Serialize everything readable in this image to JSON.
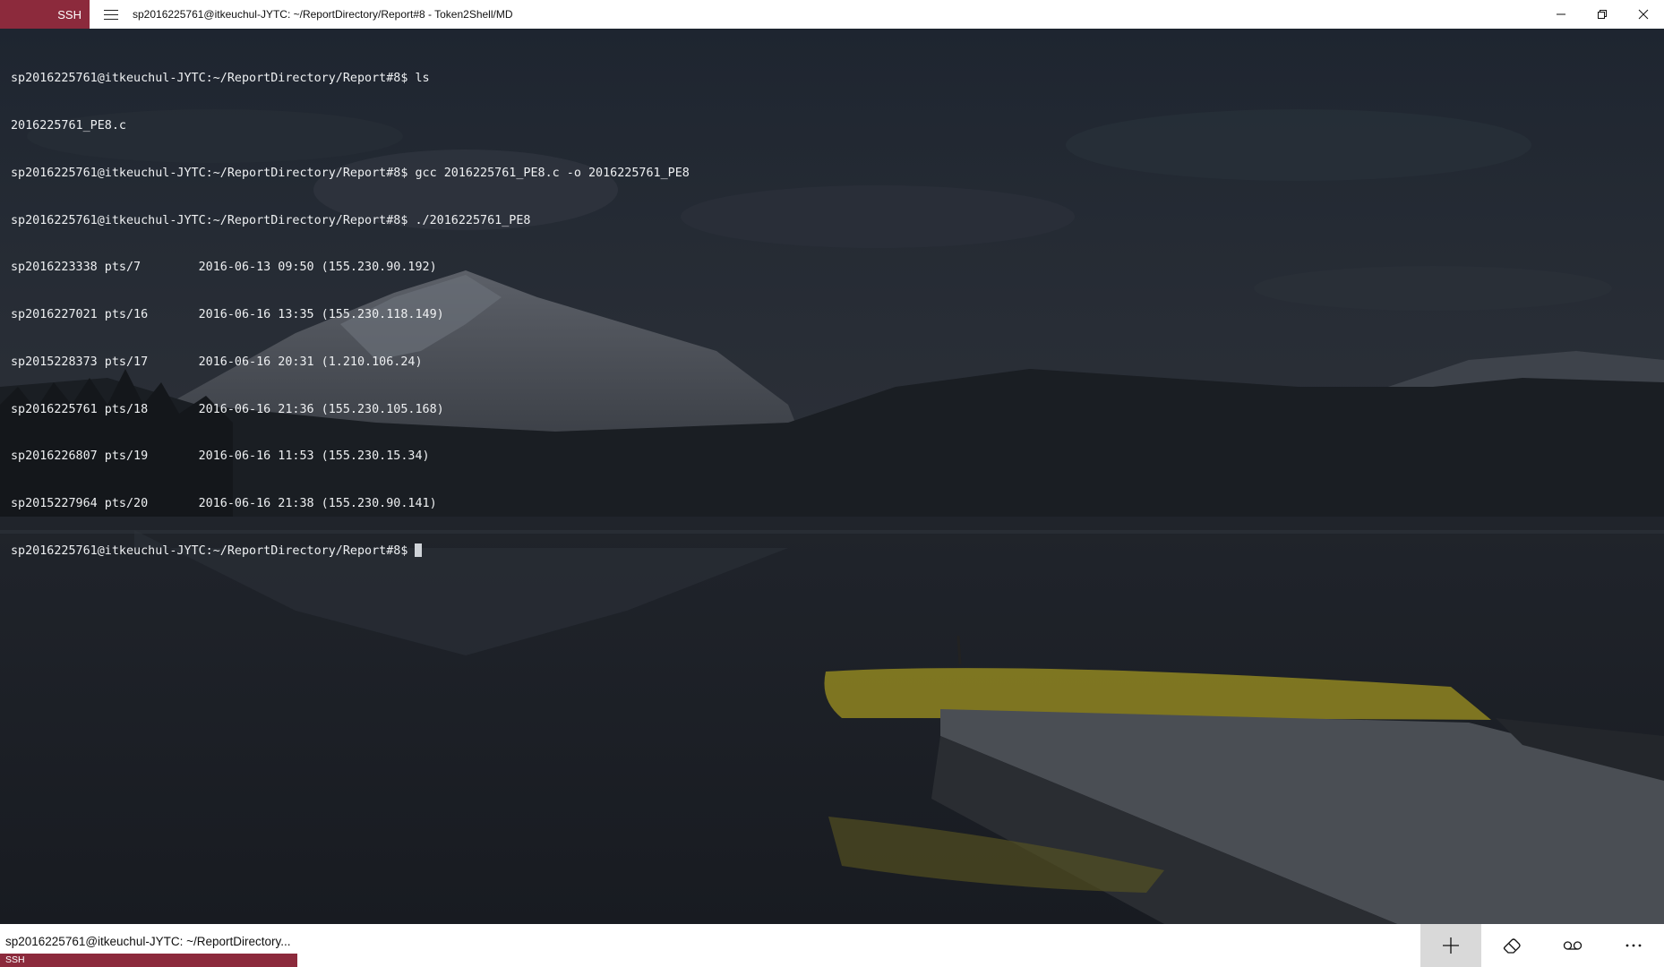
{
  "app": {
    "badge_label": "SSH",
    "window_title": "sp2016225761@itkeuchul-JYTC: ~/ReportDirectory/Report#8 - Token2Shell/MD",
    "accent_color": "#8c2a3c"
  },
  "window_controls": {
    "minimize_icon": "minimize-icon",
    "restore_icon": "restore-icon",
    "close_icon": "close-icon"
  },
  "terminal": {
    "lines": [
      "sp2016225761@itkeuchul-JYTC:~/ReportDirectory/Report#8$ ls",
      "2016225761_PE8.c",
      "sp2016225761@itkeuchul-JYTC:~/ReportDirectory/Report#8$ gcc 2016225761_PE8.c -o 2016225761_PE8",
      "sp2016225761@itkeuchul-JYTC:~/ReportDirectory/Report#8$ ./2016225761_PE8",
      "sp2016223338 pts/7        2016-06-13 09:50 (155.230.90.192)",
      "sp2016227021 pts/16       2016-06-16 13:35 (155.230.118.149)",
      "sp2015228373 pts/17       2016-06-16 20:31 (1.210.106.24)",
      "sp2016225761 pts/18       2016-06-16 21:36 (155.230.105.168)",
      "sp2016226807 pts/19       2016-06-16 11:53 (155.230.15.34)",
      "sp2015227964 pts/20       2016-06-16 21:38 (155.230.90.141)"
    ],
    "prompt": "sp2016225761@itkeuchul-JYTC:~/ReportDirectory/Report#8$ "
  },
  "bottom_bar": {
    "session_title": "sp2016225761@itkeuchul-JYTC: ~/ReportDirectory...",
    "session_type": "SSH",
    "tools": [
      {
        "icon": "add-icon",
        "active": true
      },
      {
        "icon": "eraser-icon",
        "active": false
      },
      {
        "icon": "voicemail-icon",
        "active": false
      },
      {
        "icon": "more-icon",
        "active": false
      }
    ]
  }
}
